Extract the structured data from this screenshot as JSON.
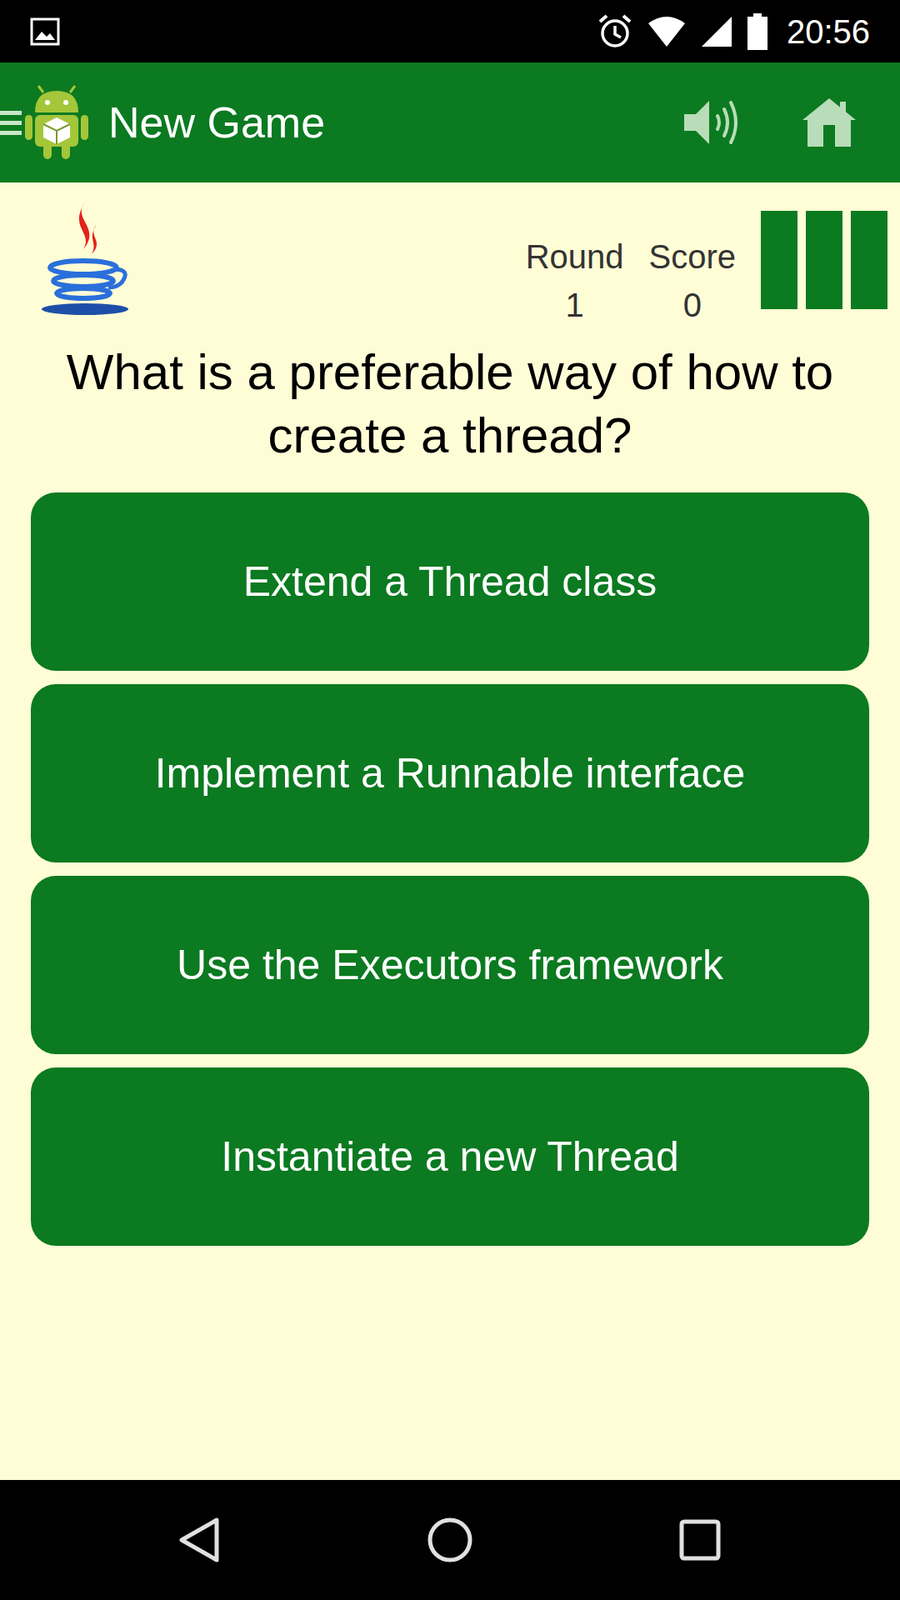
{
  "status_bar": {
    "time": "20:56"
  },
  "app_bar": {
    "title": "New Game",
    "sound_on": true
  },
  "stats": [
    {
      "label": "Round",
      "value": "1"
    },
    {
      "label": "Score",
      "value": "0"
    }
  ],
  "lives": [
    {
      "filled": true
    },
    {
      "filled": true
    },
    {
      "filled": true
    }
  ],
  "question": "What is a preferable way of how to create a thread?",
  "answers": [
    {
      "label": "Extend a Thread class"
    },
    {
      "label": "Implement a Runnable interface"
    },
    {
      "label": "Use the Executors framework"
    },
    {
      "label": "Instantiate a new Thread"
    }
  ]
}
